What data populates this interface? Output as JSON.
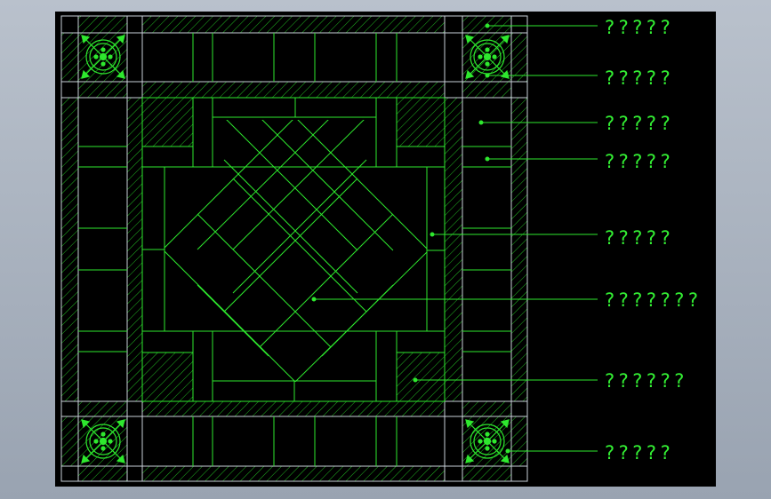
{
  "colors": {
    "background": "#000000",
    "outer_frame": "#c9d1d9",
    "drawing_lines": "#2ee82e",
    "hatch": "#22b822",
    "labels": "#33ee33",
    "viewport_bg": "#a4adba"
  },
  "callouts": [
    {
      "text": "?????"
    },
    {
      "text": "?????"
    },
    {
      "text": "?????"
    },
    {
      "text": "?????"
    },
    {
      "text": "?????"
    },
    {
      "text": "???????"
    },
    {
      "text": "??????"
    },
    {
      "text": "?????"
    }
  ],
  "corner_fixture_icon": "ceiling-vent-fixture-icon"
}
